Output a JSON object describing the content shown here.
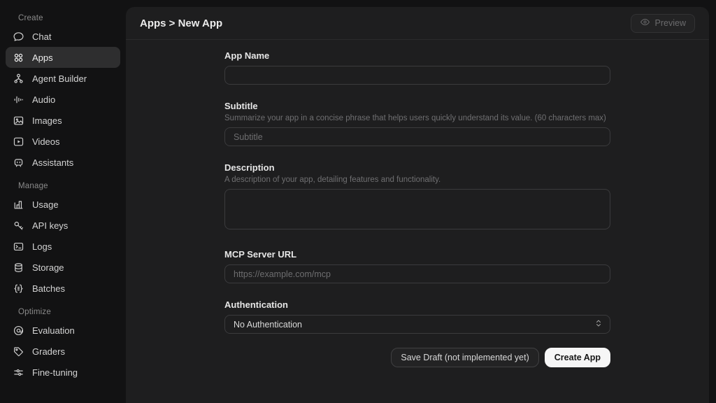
{
  "sidebar": {
    "sections": [
      {
        "label": "Create",
        "items": [
          {
            "label": "Chat",
            "icon": "chat-icon",
            "active": false
          },
          {
            "label": "Apps",
            "icon": "apps-icon",
            "active": true
          },
          {
            "label": "Agent Builder",
            "icon": "agent-builder-icon",
            "active": false
          },
          {
            "label": "Audio",
            "icon": "audio-icon",
            "active": false
          },
          {
            "label": "Images",
            "icon": "images-icon",
            "active": false
          },
          {
            "label": "Videos",
            "icon": "videos-icon",
            "active": false
          },
          {
            "label": "Assistants",
            "icon": "assistants-icon",
            "active": false
          }
        ]
      },
      {
        "label": "Manage",
        "items": [
          {
            "label": "Usage",
            "icon": "usage-icon",
            "active": false
          },
          {
            "label": "API keys",
            "icon": "api-keys-icon",
            "active": false
          },
          {
            "label": "Logs",
            "icon": "logs-icon",
            "active": false
          },
          {
            "label": "Storage",
            "icon": "storage-icon",
            "active": false
          },
          {
            "label": "Batches",
            "icon": "batches-icon",
            "active": false
          }
        ]
      },
      {
        "label": "Optimize",
        "items": [
          {
            "label": "Evaluation",
            "icon": "evaluation-icon",
            "active": false
          },
          {
            "label": "Graders",
            "icon": "graders-icon",
            "active": false
          },
          {
            "label": "Fine-tuning",
            "icon": "fine-tuning-icon",
            "active": false
          }
        ]
      }
    ]
  },
  "header": {
    "breadcrumb": "Apps > New App",
    "preview_label": "Preview"
  },
  "form": {
    "app_name": {
      "label": "App Name",
      "value": "",
      "placeholder": ""
    },
    "subtitle": {
      "label": "Subtitle",
      "helper": "Summarize your app in a concise phrase that helps users quickly understand its value. (60 characters max)",
      "placeholder": "Subtitle",
      "value": ""
    },
    "description": {
      "label": "Description",
      "helper": "A description of your app, detailing features and functionality.",
      "value": ""
    },
    "mcp_url": {
      "label": "MCP Server URL",
      "placeholder": "https://example.com/mcp",
      "value": ""
    },
    "authentication": {
      "label": "Authentication",
      "value": "No Authentication"
    },
    "buttons": {
      "save_draft": "Save Draft (not implemented yet)",
      "create": "Create App"
    }
  },
  "colors": {
    "page_bg": "#121213",
    "panel_bg": "#1e1e1f",
    "active_item_bg": "#2e2e2f",
    "input_border": "#3b3b3d",
    "primary_button_bg": "#f6f6f6",
    "primary_button_text": "#161616"
  }
}
